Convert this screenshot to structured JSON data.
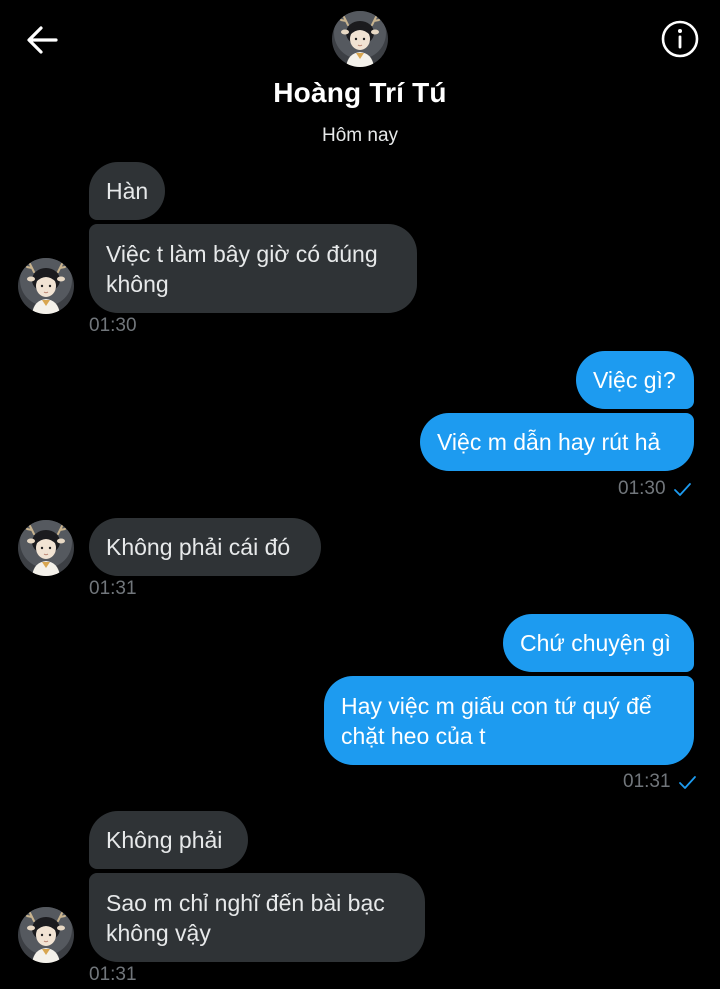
{
  "header": {
    "contact_name": "Hoàng Trí Tú",
    "date_separator": "Hôm nay"
  },
  "colors": {
    "background": "#000000",
    "received_bubble": "#2f3336",
    "sent_bubble": "#1d9bf0",
    "timestamp": "#71767b",
    "read_check": "#1d9bf0"
  },
  "messages": [
    {
      "direction": "received",
      "text": "Hàn"
    },
    {
      "direction": "received",
      "text": "Việc t làm bây giờ có đúng không",
      "time": "01:30"
    },
    {
      "direction": "sent",
      "text": "Việc gì?"
    },
    {
      "direction": "sent",
      "text": "Việc m dẫn hay rút hả",
      "time": "01:30",
      "status_icon": "check-icon"
    },
    {
      "direction": "received",
      "text": "Không phải cái đó",
      "time": "01:31"
    },
    {
      "direction": "sent",
      "text": "Chứ chuyện gì"
    },
    {
      "direction": "sent",
      "text": "Hay việc m giấu con tứ quý để chặt heo của t",
      "time": "01:31",
      "status_icon": "check-icon"
    },
    {
      "direction": "received",
      "text": "Không phải"
    },
    {
      "direction": "received",
      "text": "Sao m chỉ nghĩ đến bài bạc không vậy",
      "time": "01:31"
    }
  ]
}
